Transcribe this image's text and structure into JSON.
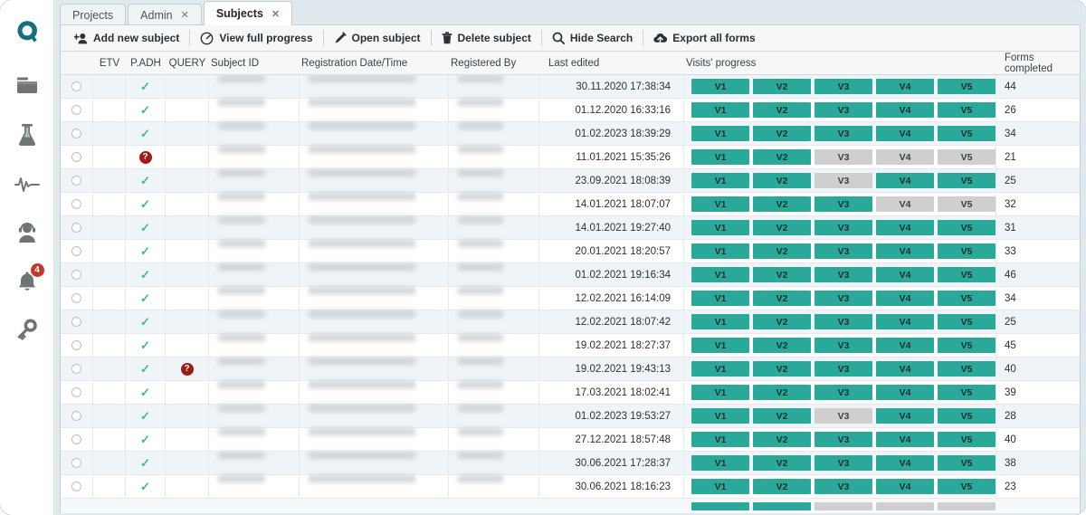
{
  "sidebar": {
    "items": [
      {
        "name": "logo",
        "icon": "q-logo-icon",
        "label": "Q"
      },
      {
        "name": "projects",
        "icon": "folder-icon",
        "label": "Projects"
      },
      {
        "name": "studies",
        "icon": "flask-icon",
        "label": "Studies"
      },
      {
        "name": "monitoring",
        "icon": "pulse-icon",
        "label": "Monitoring"
      },
      {
        "name": "support",
        "icon": "headset-user-icon",
        "label": "Support"
      },
      {
        "name": "notifications",
        "icon": "bell-icon",
        "label": "Notifications",
        "badge": "4"
      },
      {
        "name": "access",
        "icon": "key-icon",
        "label": "Access"
      }
    ]
  },
  "tabs": [
    {
      "label": "Projects",
      "active": false,
      "closable": false
    },
    {
      "label": "Admin",
      "active": false,
      "closable": true
    },
    {
      "label": "Subjects",
      "active": true,
      "closable": true
    }
  ],
  "toolbar": {
    "buttons": [
      {
        "label": "Add new subject",
        "icon": "add-user-icon"
      },
      {
        "label": "View full progress",
        "icon": "gauge-icon"
      },
      {
        "label": "Open subject",
        "icon": "pencil-icon"
      },
      {
        "label": "Delete subject",
        "icon": "trash-icon"
      },
      {
        "label": "Hide Search",
        "icon": "search-icon"
      },
      {
        "label": "Export all forms",
        "icon": "export-icon"
      }
    ]
  },
  "table": {
    "columns": [
      "",
      "ETV",
      "P.ADH",
      "QUERY",
      "Subject ID",
      "Registration Date/Time",
      "Registered By",
      "Last edited",
      "Visits' progress",
      "Forms completed"
    ],
    "visit_labels": [
      "V1",
      "V2",
      "V3",
      "V4",
      "V5"
    ],
    "rows": [
      {
        "etv": "",
        "padh": "check",
        "query": "",
        "subject_id": "redacted",
        "registration": "redacted",
        "registered_by": "redacted",
        "last_edited": "30.11.2020 17:38:34",
        "visits": [
          1,
          1,
          1,
          1,
          1
        ],
        "forms_completed": "44"
      },
      {
        "etv": "",
        "padh": "check",
        "query": "",
        "subject_id": "redacted",
        "registration": "redacted",
        "registered_by": "redacted",
        "last_edited": "01.12.2020 16:33:16",
        "visits": [
          1,
          1,
          1,
          1,
          1
        ],
        "forms_completed": "26"
      },
      {
        "etv": "",
        "padh": "check",
        "query": "",
        "subject_id": "redacted",
        "registration": "redacted",
        "registered_by": "redacted",
        "last_edited": "01.02.2023 18:39:29",
        "visits": [
          1,
          1,
          1,
          1,
          1
        ],
        "forms_completed": "34"
      },
      {
        "etv": "",
        "padh": "question",
        "query": "",
        "subject_id": "redacted",
        "registration": "redacted",
        "registered_by": "redacted",
        "last_edited": "11.01.2021 15:35:26",
        "visits": [
          1,
          1,
          0,
          0,
          0
        ],
        "forms_completed": "21"
      },
      {
        "etv": "",
        "padh": "check",
        "query": "",
        "subject_id": "redacted",
        "registration": "redacted",
        "registered_by": "redacted",
        "last_edited": "23.09.2021 18:08:39",
        "visits": [
          1,
          1,
          0,
          1,
          1
        ],
        "forms_completed": "25"
      },
      {
        "etv": "",
        "padh": "check",
        "query": "",
        "subject_id": "redacted",
        "registration": "redacted",
        "registered_by": "redacted",
        "last_edited": "14.01.2021 18:07:07",
        "visits": [
          1,
          1,
          1,
          0,
          0
        ],
        "forms_completed": "32"
      },
      {
        "etv": "",
        "padh": "check",
        "query": "",
        "subject_id": "redacted",
        "registration": "redacted",
        "registered_by": "redacted",
        "last_edited": "14.01.2021 19:27:40",
        "visits": [
          1,
          1,
          1,
          1,
          1
        ],
        "forms_completed": "31"
      },
      {
        "etv": "",
        "padh": "check",
        "query": "",
        "subject_id": "redacted",
        "registration": "redacted",
        "registered_by": "redacted",
        "last_edited": "20.01.2021 18:20:57",
        "visits": [
          1,
          1,
          1,
          1,
          1
        ],
        "forms_completed": "33"
      },
      {
        "etv": "",
        "padh": "check",
        "query": "",
        "subject_id": "redacted",
        "registration": "redacted",
        "registered_by": "redacted",
        "last_edited": "01.02.2021 19:16:34",
        "visits": [
          1,
          1,
          1,
          1,
          1
        ],
        "forms_completed": "46"
      },
      {
        "etv": "",
        "padh": "check",
        "query": "",
        "subject_id": "redacted",
        "registration": "redacted",
        "registered_by": "redacted",
        "last_edited": "12.02.2021 16:14:09",
        "visits": [
          1,
          1,
          1,
          1,
          1
        ],
        "forms_completed": "34"
      },
      {
        "etv": "",
        "padh": "check",
        "query": "",
        "subject_id": "redacted",
        "registration": "redacted",
        "registered_by": "redacted",
        "last_edited": "12.02.2021 18:07:42",
        "visits": [
          1,
          1,
          1,
          1,
          1
        ],
        "forms_completed": "25"
      },
      {
        "etv": "",
        "padh": "check",
        "query": "",
        "subject_id": "redacted",
        "registration": "redacted",
        "registered_by": "redacted",
        "last_edited": "19.02.2021 18:27:37",
        "visits": [
          1,
          1,
          1,
          1,
          1
        ],
        "forms_completed": "45"
      },
      {
        "etv": "",
        "padh": "check",
        "query": "question",
        "subject_id": "redacted",
        "registration": "redacted",
        "registered_by": "redacted",
        "last_edited": "19.02.2021 19:43:13",
        "visits": [
          1,
          1,
          1,
          1,
          1
        ],
        "forms_completed": "40"
      },
      {
        "etv": "",
        "padh": "check",
        "query": "",
        "subject_id": "redacted",
        "registration": "redacted",
        "registered_by": "redacted",
        "last_edited": "17.03.2021 18:02:41",
        "visits": [
          1,
          1,
          1,
          1,
          1
        ],
        "forms_completed": "39"
      },
      {
        "etv": "",
        "padh": "check",
        "query": "",
        "subject_id": "redacted",
        "registration": "redacted",
        "registered_by": "redacted",
        "last_edited": "01.02.2023 19:53:27",
        "visits": [
          1,
          1,
          0,
          1,
          1
        ],
        "forms_completed": "28"
      },
      {
        "etv": "",
        "padh": "check",
        "query": "",
        "subject_id": "redacted",
        "registration": "redacted",
        "registered_by": "redacted",
        "last_edited": "27.12.2021 18:57:48",
        "visits": [
          1,
          1,
          1,
          1,
          1
        ],
        "forms_completed": "40"
      },
      {
        "etv": "",
        "padh": "check",
        "query": "",
        "subject_id": "redacted",
        "registration": "redacted",
        "registered_by": "redacted",
        "last_edited": "30.06.2021 17:28:37",
        "visits": [
          1,
          1,
          1,
          1,
          1
        ],
        "forms_completed": "38"
      },
      {
        "etv": "",
        "padh": "check",
        "query": "",
        "subject_id": "redacted",
        "registration": "redacted",
        "registered_by": "redacted",
        "last_edited": "30.06.2021 18:16:23",
        "visits": [
          1,
          1,
          1,
          1,
          1
        ],
        "forms_completed": "23"
      }
    ],
    "partial_row": {
      "visits": [
        1,
        1,
        0,
        0,
        0
      ]
    }
  },
  "colors": {
    "accent_teal": "#2aa899",
    "check_teal": "#3cb7a4",
    "badge_red": "#c0392b",
    "query_red": "#9d1c13",
    "chrome_blue": "#dfe9ee",
    "row_alt": "#eef4f8",
    "visit_todo_gray": "#cfcfcf"
  }
}
